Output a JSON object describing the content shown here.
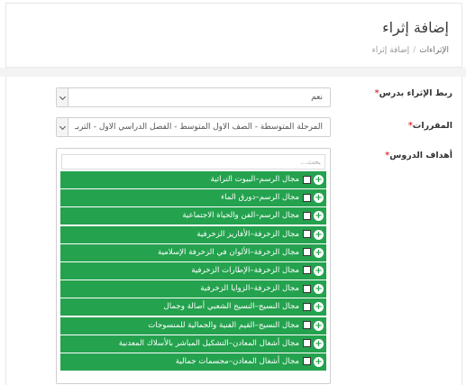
{
  "page": {
    "title": "إضافة إثراء",
    "breadcrumb": {
      "parent": "الإثراءات",
      "separator": "/",
      "current": "إضافة إثراء"
    }
  },
  "form": {
    "link_to_lesson": {
      "label": "ربط الإثراء بدرس",
      "required_mark": "*",
      "value": "نعم"
    },
    "curricula": {
      "label": "المقررات",
      "required_mark": "*",
      "value": "المرحلة المتوسطة - الصف الأول المتوسط - الفصل الدراسي الأول - التربـ"
    },
    "lesson_objectives": {
      "label": "أهداف الدروس",
      "required_mark": "*",
      "search_placeholder": "بحث...",
      "items": [
        {
          "label": "مجال الرسم–البيوت التراثية",
          "checked": false
        },
        {
          "label": "مجال الرسم–دورق الماء",
          "checked": false
        },
        {
          "label": "مجال الرسم–الفن والحياة الاجتماعية",
          "checked": false
        },
        {
          "label": "مجال الزخرفة–الأفاريز الزخرفية",
          "checked": false
        },
        {
          "label": "مجال الزخرفة–الألوان في الزخرفة الإسلامية",
          "checked": false
        },
        {
          "label": "مجال الزخرفة–الإطارات الزخرفية",
          "checked": false
        },
        {
          "label": "مجال الزخرفة–الزوايا الزخرفية",
          "checked": false
        },
        {
          "label": "مجال النسيج–النسيج الشعبي أصالة وجمال",
          "checked": false
        },
        {
          "label": "مجال النسيج–القيم الفنية والجمالية للمنسوجات",
          "checked": false
        },
        {
          "label": "مجال أشغال المعادن–التشكيل المباشر بالأسلاك المعدنية",
          "checked": false
        },
        {
          "label": "مجال أشغال المعادن–مجسمات جمالية",
          "checked": false
        }
      ]
    }
  },
  "colors": {
    "item_bg": "#24a24e",
    "required": "#e23b3b"
  },
  "icons": {
    "item_expand": "plus-circle-icon",
    "dropdown": "chevron-down-icon"
  }
}
